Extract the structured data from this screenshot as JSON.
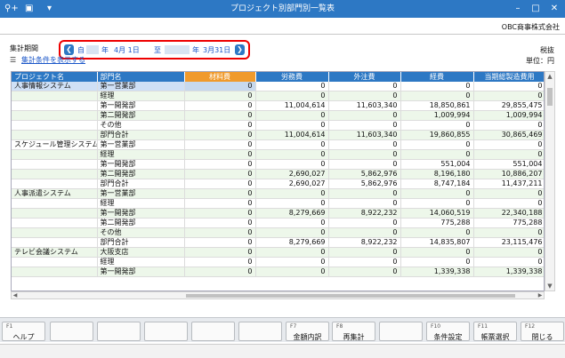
{
  "window": {
    "title": "プロジェクト別部門別一覧表"
  },
  "toolbar_icons": [
    "pin-plus-icon",
    "excel-icon",
    "menu-arrow-icon"
  ],
  "company_name": "OBC商事株式会社",
  "period": {
    "label": "集計期間",
    "from_prefix": "自",
    "from_year_suffix": "年",
    "from_date": "4月 1日",
    "to_prefix": "至",
    "to_year_suffix": "年",
    "to_date": "3月31日"
  },
  "tax_label": "税抜",
  "unit_label": "単位：円",
  "show_conditions_link": "集計条件を表示する",
  "columns": [
    "プロジェクト名",
    "部門名",
    "材料費",
    "労務費",
    "外注費",
    "経費",
    "当期総製造費用"
  ],
  "rows": [
    {
      "project": "人事情報システム",
      "dept": "第一営業部",
      "mat": "0",
      "labor": "0",
      "out": "0",
      "exp": "0",
      "total": "0"
    },
    {
      "project": "",
      "dept": "経理",
      "mat": "0",
      "labor": "0",
      "out": "0",
      "exp": "0",
      "total": "0"
    },
    {
      "project": "",
      "dept": "第一開発部",
      "mat": "0",
      "labor": "11,004,614",
      "out": "11,603,340",
      "exp": "18,850,861",
      "total": "29,855,475"
    },
    {
      "project": "",
      "dept": "第二開発部",
      "mat": "0",
      "labor": "0",
      "out": "0",
      "exp": "1,009,994",
      "total": "1,009,994"
    },
    {
      "project": "",
      "dept": "その他",
      "mat": "0",
      "labor": "0",
      "out": "0",
      "exp": "0",
      "total": "0"
    },
    {
      "project": "",
      "dept": "部門合計",
      "mat": "0",
      "labor": "11,004,614",
      "out": "11,603,340",
      "exp": "19,860,855",
      "total": "30,865,469"
    },
    {
      "project": "スケジュール管理システム",
      "dept": "第一営業部",
      "mat": "0",
      "labor": "0",
      "out": "0",
      "exp": "0",
      "total": "0"
    },
    {
      "project": "",
      "dept": "経理",
      "mat": "0",
      "labor": "0",
      "out": "0",
      "exp": "0",
      "total": "0"
    },
    {
      "project": "",
      "dept": "第一開発部",
      "mat": "0",
      "labor": "0",
      "out": "0",
      "exp": "551,004",
      "total": "551,004"
    },
    {
      "project": "",
      "dept": "第二開発部",
      "mat": "0",
      "labor": "2,690,027",
      "out": "5,862,976",
      "exp": "8,196,180",
      "total": "10,886,207"
    },
    {
      "project": "",
      "dept": "部門合計",
      "mat": "0",
      "labor": "2,690,027",
      "out": "5,862,976",
      "exp": "8,747,184",
      "total": "11,437,211"
    },
    {
      "project": "人事派遣システム",
      "dept": "第一営業部",
      "mat": "0",
      "labor": "0",
      "out": "0",
      "exp": "0",
      "total": "0"
    },
    {
      "project": "",
      "dept": "経理",
      "mat": "0",
      "labor": "0",
      "out": "0",
      "exp": "0",
      "total": "0"
    },
    {
      "project": "",
      "dept": "第一開発部",
      "mat": "0",
      "labor": "8,279,669",
      "out": "8,922,232",
      "exp": "14,060,519",
      "total": "22,340,188"
    },
    {
      "project": "",
      "dept": "第二開発部",
      "mat": "0",
      "labor": "0",
      "out": "0",
      "exp": "775,288",
      "total": "775,288"
    },
    {
      "project": "",
      "dept": "その他",
      "mat": "0",
      "labor": "0",
      "out": "0",
      "exp": "0",
      "total": "0"
    },
    {
      "project": "",
      "dept": "部門合計",
      "mat": "0",
      "labor": "8,279,669",
      "out": "8,922,232",
      "exp": "14,835,807",
      "total": "23,115,476"
    },
    {
      "project": "テレビ会議システム",
      "dept": "大阪支店",
      "mat": "0",
      "labor": "0",
      "out": "0",
      "exp": "0",
      "total": "0"
    },
    {
      "project": "",
      "dept": "経理",
      "mat": "0",
      "labor": "0",
      "out": "0",
      "exp": "0",
      "total": "0"
    },
    {
      "project": "",
      "dept": "第一開発部",
      "mat": "0",
      "labor": "0",
      "out": "0",
      "exp": "1,339,338",
      "total": "1,339,338"
    }
  ],
  "fkeys": [
    {
      "key": "F1",
      "label": "ヘルプ"
    },
    {
      "key": "",
      "label": ""
    },
    {
      "key": "",
      "label": ""
    },
    {
      "key": "",
      "label": ""
    },
    {
      "key": "",
      "label": ""
    },
    {
      "key": "",
      "label": ""
    },
    {
      "key": "F7",
      "label": "金額内訳"
    },
    {
      "key": "F8",
      "label": "再集計"
    },
    {
      "key": "",
      "label": ""
    },
    {
      "key": "F10",
      "label": "条件設定"
    },
    {
      "key": "F11",
      "label": "帳票選択"
    },
    {
      "key": "F12",
      "label": "閉じる"
    }
  ]
}
